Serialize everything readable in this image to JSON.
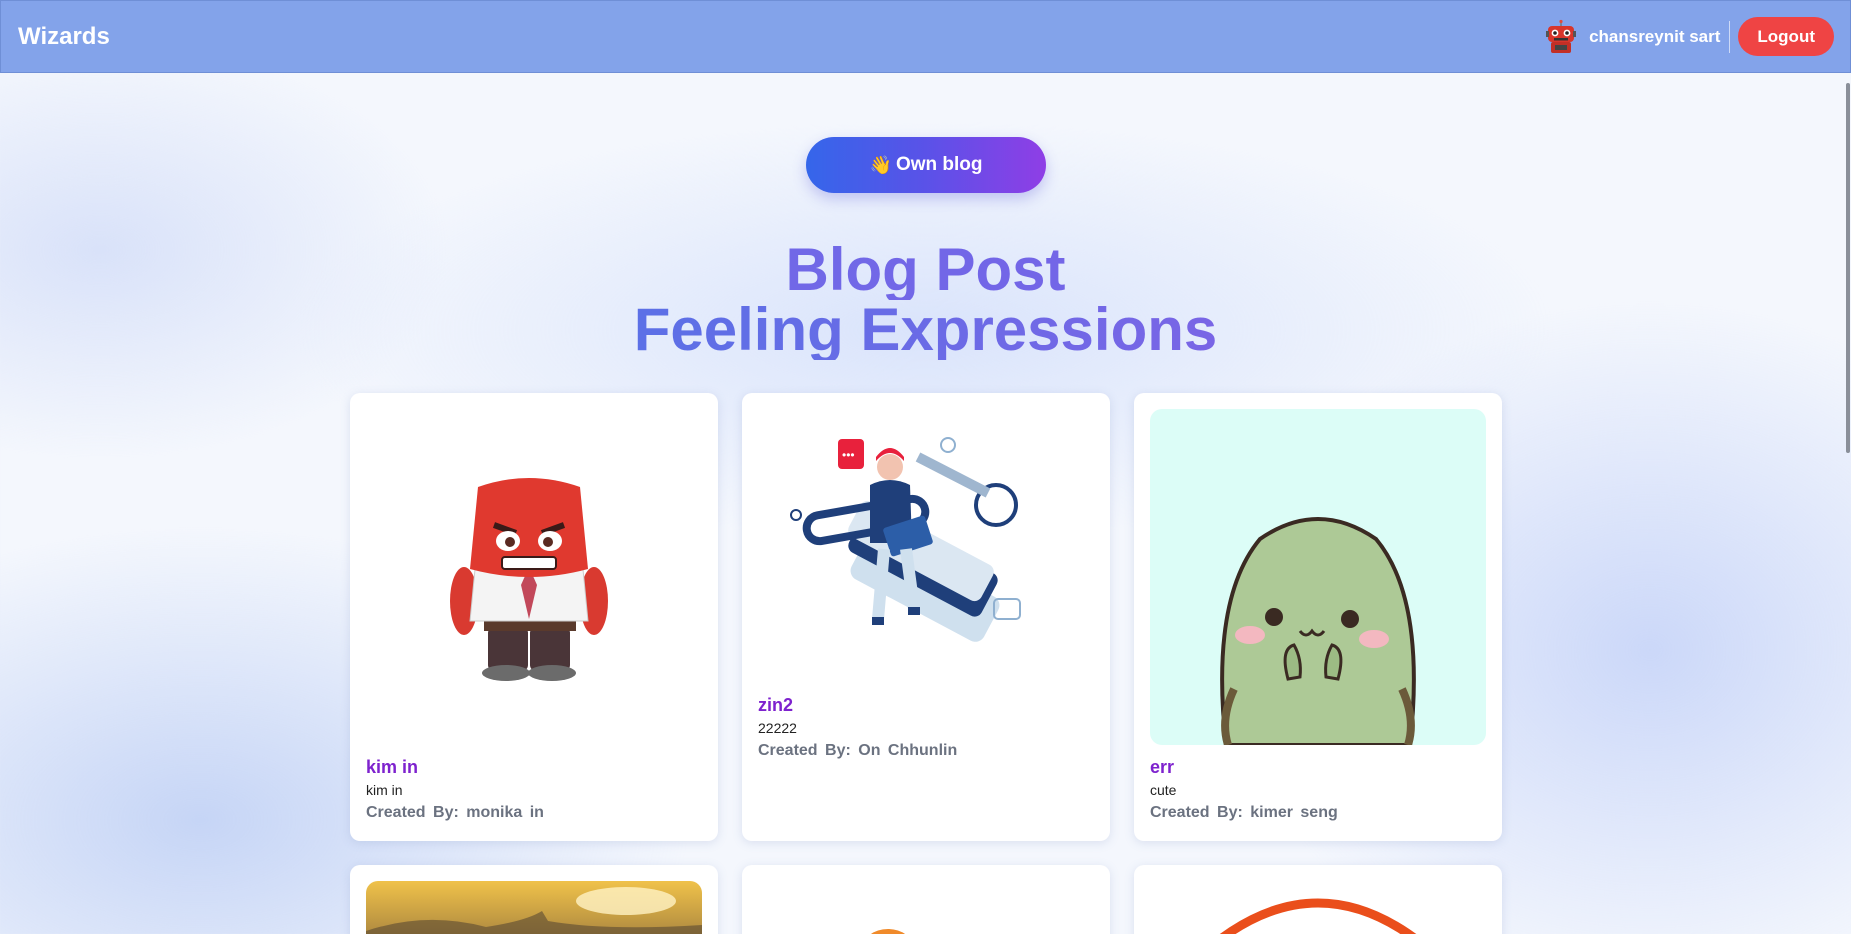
{
  "navbar": {
    "brand": "Wizards",
    "username": "chansreynit sart",
    "logout_label": "Logout",
    "avatar_icon": "robot-avatar-icon"
  },
  "own_blog": {
    "emoji": "👋",
    "label": "Own blog"
  },
  "hero": {
    "line1": "Blog Post",
    "line2": "Feeling Expressions"
  },
  "posts": [
    {
      "title": "kim in",
      "description": "kim in",
      "author_label": "Created By:",
      "author": "monika  in",
      "image": "angry-red-character"
    },
    {
      "title": "zin2",
      "description": "22222",
      "author_label": "Created By:",
      "author": "On  Chhunlin",
      "image": "isometric-laptop-key-illustration"
    },
    {
      "title": "err",
      "description": "cute",
      "author_label": "Created By:",
      "author": "kimer  seng",
      "image": "cute-green-turtle"
    },
    {
      "image": "sunset-landscape"
    },
    {
      "image": "orange-character"
    },
    {
      "image": "orange-ring"
    }
  ],
  "colors": {
    "navbar": "#83a3ea",
    "logout": "#ef4444",
    "title_accent": "#7e22ce",
    "gradient_start": "#3566ea",
    "gradient_end": "#8f3ee6"
  }
}
